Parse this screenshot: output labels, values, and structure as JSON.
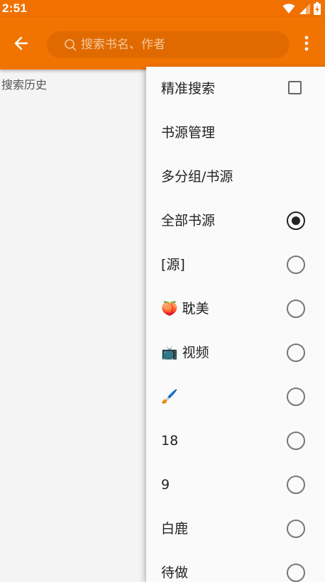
{
  "status_bar": {
    "time": "2:51",
    "icons": [
      "wifi-icon",
      "signal-icon",
      "battery-icon"
    ]
  },
  "toolbar": {
    "back_icon": "arrow-left-icon",
    "search_placeholder": "搜索书名、作者",
    "more_icon": "more-vertical-icon",
    "color": "#f27400"
  },
  "main": {
    "history_label": "搜索历史"
  },
  "menu": {
    "items": [
      {
        "label": "精准搜索",
        "control": "checkbox",
        "checked": false
      },
      {
        "label": "书源管理",
        "control": "none"
      },
      {
        "label": "多分组/书源",
        "control": "none"
      },
      {
        "label": "全部书源",
        "control": "radio",
        "checked": true
      },
      {
        "label": "[源]",
        "control": "radio",
        "checked": false
      },
      {
        "emoji": "🍑",
        "label": "耽美",
        "control": "radio",
        "checked": false
      },
      {
        "emoji": "📺",
        "label": "视频",
        "control": "radio",
        "checked": false
      },
      {
        "emoji": "🖌️",
        "label": "",
        "control": "radio",
        "checked": false
      },
      {
        "label": "18",
        "control": "radio",
        "checked": false
      },
      {
        "label": "9",
        "control": "radio",
        "checked": false
      },
      {
        "label": "白鹿",
        "control": "radio",
        "checked": false
      },
      {
        "label": "待做",
        "control": "radio",
        "checked": false
      }
    ]
  }
}
